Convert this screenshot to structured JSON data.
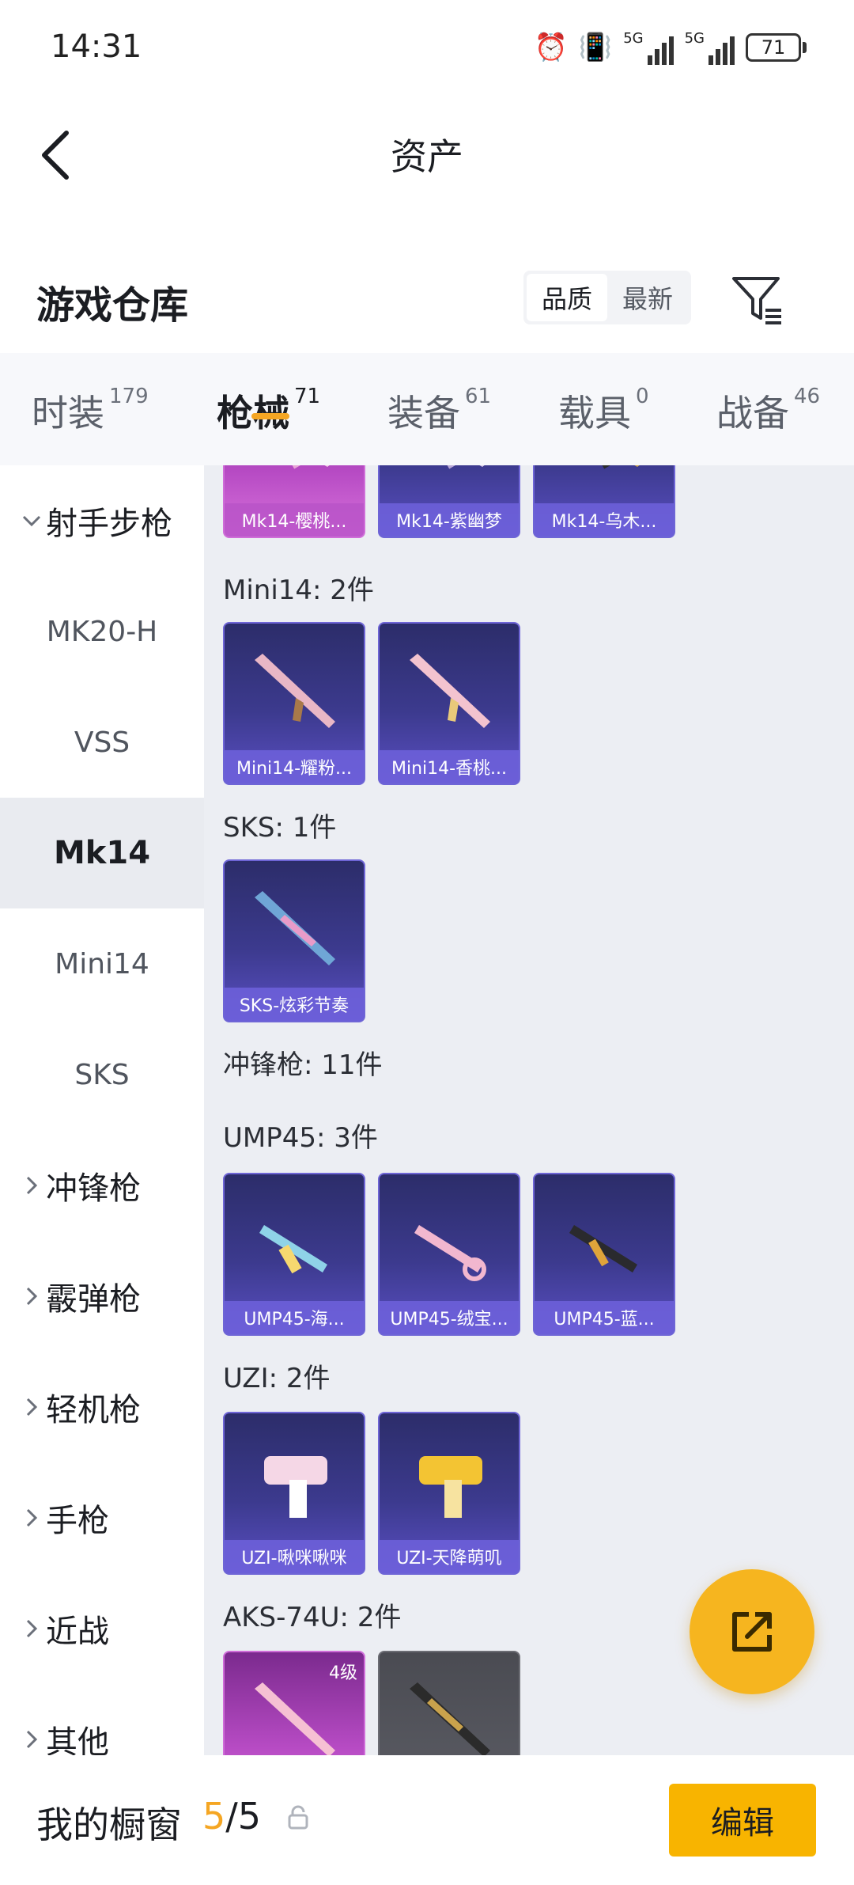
{
  "status_bar": {
    "time": "14:31",
    "network_1": "5G",
    "network_2": "5G",
    "battery": "71"
  },
  "header": {
    "title": "资产"
  },
  "section": {
    "title": "游戏仓库",
    "sort_options": [
      "品质",
      "最新"
    ],
    "sort_active": "品质"
  },
  "tabs": [
    {
      "label": "时装",
      "count": "179"
    },
    {
      "label": "枪械",
      "count": "71",
      "active": true
    },
    {
      "label": "装备",
      "count": "61"
    },
    {
      "label": "载具",
      "count": "0"
    },
    {
      "label": "战备",
      "count": "46"
    }
  ],
  "sidebar": {
    "items": [
      {
        "label": "射手步枪",
        "kind": "group",
        "expanded": true
      },
      {
        "label": "MK20-H",
        "kind": "sub"
      },
      {
        "label": "VSS",
        "kind": "sub"
      },
      {
        "label": "Mk14",
        "kind": "sub",
        "active": true
      },
      {
        "label": "Mini14",
        "kind": "sub"
      },
      {
        "label": "SKS",
        "kind": "sub"
      },
      {
        "label": "冲锋枪",
        "kind": "group"
      },
      {
        "label": "霰弹枪",
        "kind": "group"
      },
      {
        "label": "轻机枪",
        "kind": "group"
      },
      {
        "label": "手枪",
        "kind": "group"
      },
      {
        "label": "近战",
        "kind": "group"
      },
      {
        "label": "其他",
        "kind": "group"
      }
    ]
  },
  "content": {
    "mk14_cards": [
      "Mk14-樱桃...",
      "Mk14-紫幽梦",
      "Mk14-乌木..."
    ],
    "mini14_label": "Mini14: 2件",
    "mini14_cards": [
      "Mini14-耀粉...",
      "Mini14-香桃..."
    ],
    "sks_label": "SKS: 1件",
    "sks_cards": [
      "SKS-炫彩节奏"
    ],
    "smg_label": "冲锋枪: 11件",
    "ump45_label": "UMP45: 3件",
    "ump45_cards": [
      "UMP45-海...",
      "UMP45-绒宝...",
      "UMP45-蓝..."
    ],
    "uzi_label": "UZI: 2件",
    "uzi_cards": [
      "UZI-啾咪啾咪",
      "UZI-天降萌叽"
    ],
    "aks_label": "AKS-74U: 2件",
    "aks_card_level": "4级"
  },
  "bottom_bar": {
    "title": "我的橱窗",
    "current": "5",
    "total": "/5",
    "edit_label": "编辑"
  },
  "colors": {
    "accent": "#f5a623",
    "edit_button": "#f8b400",
    "card_purple": "#3c3a8e",
    "card_pink": "#b74bc4"
  }
}
